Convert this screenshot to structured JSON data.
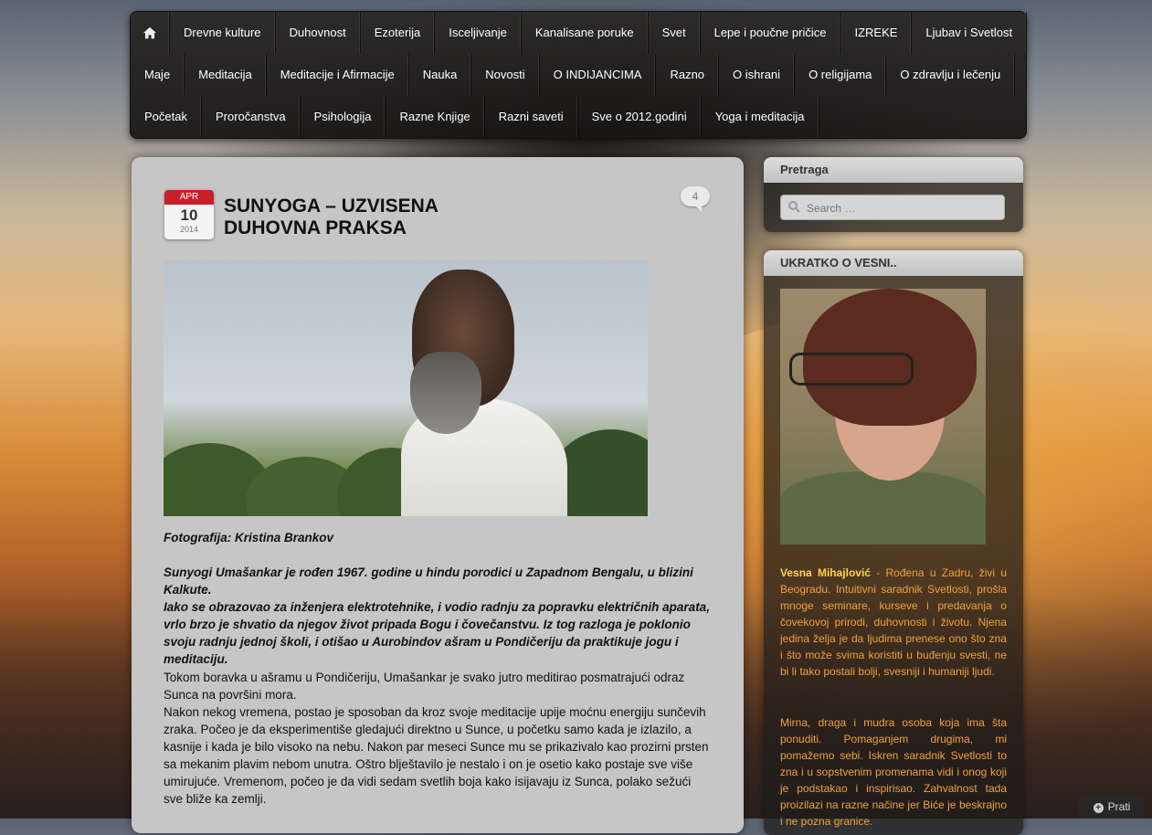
{
  "nav": {
    "home_icon": "home-icon",
    "row1": [
      "Drevne kulture",
      "Duhovnost",
      "Ezoterija",
      "Isceljivanje",
      "Kanalisane poruke",
      "Svet",
      "Lepe i poučne pričice",
      "IZREKE",
      "Ljubav i Svetlost"
    ],
    "row2": [
      "Maje",
      "Meditacija",
      "Meditacije i Afirmacije",
      "Nauka",
      "Novosti",
      "O INDIJANCIMA",
      "Razno",
      "O ishrani",
      "O religijama",
      "O zdravlju i lečenju"
    ],
    "row3": [
      "Početak",
      "Proročanstva",
      "Psihologija",
      "Razne Knjige",
      "Razni saveti",
      "Sve o 2012.godini",
      "Yoga i meditacija"
    ]
  },
  "post": {
    "date": {
      "month": "APR",
      "day": "10",
      "year": "2014"
    },
    "title": "SUNYOGA – UZVISENA DUHOVNA PRAKSA",
    "comments": "4",
    "photo_caption": "Fotografija: Kristina Brankov",
    "para1": "Sunyogi Umašankar je rođen 1967. godine u hindu porodici u Zapadnom Bengalu, u blizini Kalkute.",
    "para2": "Iako se obrazovao za inženjera elektrotehnike, i vodio radnju za popravku električnih aparata, vrlo brzo je shvatio da njegov život pripada Bogu i čovečanstvu. Iz tog razloga je poklonio svoju radnju jednoj školi, i otišao u Aurobindov ašram u Pondičeriju da praktikuje jogu i meditaciju.",
    "para3": "Tokom boravka u ašramu u Pondičeriju, Umašankar je svako jutro meditirao posmatrajući odraz Sunca na površini mora.",
    "para4": "Nakon nekog vremena, postao je sposoban da kroz svoje meditacije upije moćnu energiju sunčevih zraka. Počeo je da eksperimentiše gledajući direktno u Sunce, u početku samo kada je izlazilo, a kasnije i kada je bilo visoko na nebu. Nakon par meseci Sunce mu se prikazivalo kao prozirni prsten sa mekanim plavim nebom unutra. Oštro blještavilo je nestalo i on je osetio kako postaje sve više umirujuće. Vremenom, počeo je da vidi sedam svetlih boja kako isijavaju iz Sunca, polako sežući sve bliže ka zemlji."
  },
  "sidebar": {
    "search_title": "Pretraga",
    "search_placeholder": "Search …",
    "about_title": "UKRATKO O VESNI..",
    "about_name": "Vesna Mihajlović",
    "about_text1": " - Rođena u Zadru, živi u Beogradu. Intuitivni saradnik Svetlosti, prošla mnoge seminare, kurseve i predavanja o čovekovoj prirodi, duhovnosti i životu. Njena jedina želja je da ljudima prenese ono što zna i što može svima koristiti u buđenju svesti, ne bi li tako postali bolji, svesniji i humaniji ljudi.",
    "about_text2": "Mirna, draga i mudra osoba koja ima šta ponuditi. Pomaganjem drugima, mi pomažemo sebi. Iskren saradnik Svetlosti to zna i u sopstvenim promenama vidi i onog koji je podstakao i inspirisao. Zahvalnost tada proizilazi na razne načine jer Biće je beskrajno i ne pozna granice."
  },
  "follow_label": "Prati"
}
